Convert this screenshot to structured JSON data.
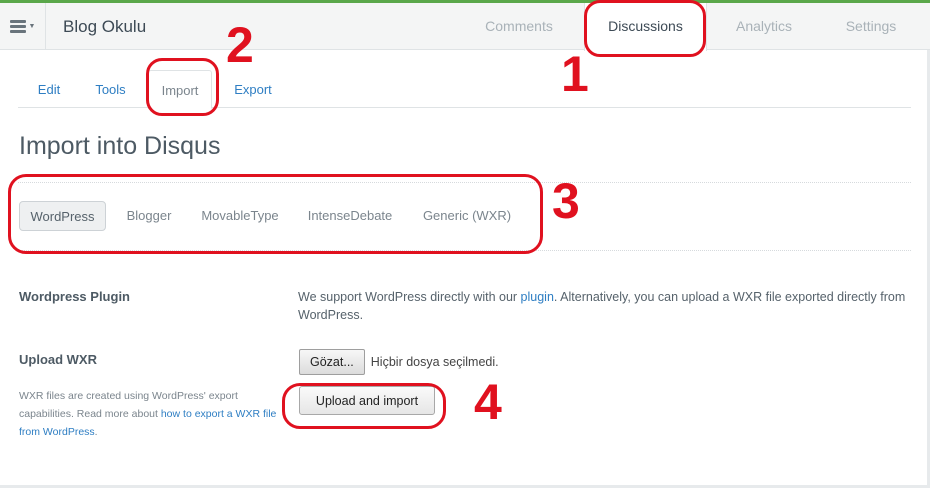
{
  "header": {
    "site_title": "Blog Okulu",
    "menu_icon": "hamburger-menu-icon",
    "tabs": [
      {
        "label": "Comments",
        "active": false
      },
      {
        "label": "Discussions",
        "active": true
      },
      {
        "label": "Analytics",
        "active": false
      },
      {
        "label": "Settings",
        "active": false
      }
    ]
  },
  "subnav": {
    "tabs": [
      {
        "label": "Edit",
        "active": false
      },
      {
        "label": "Tools",
        "active": false
      },
      {
        "label": "Import",
        "active": true
      },
      {
        "label": "Export",
        "active": false
      }
    ]
  },
  "main": {
    "title": "Import into Disqus",
    "platforms": [
      {
        "label": "WordPress",
        "active": true
      },
      {
        "label": "Blogger",
        "active": false
      },
      {
        "label": "MovableType",
        "active": false
      },
      {
        "label": "IntenseDebate",
        "active": false
      },
      {
        "label": "Generic (WXR)",
        "active": false
      }
    ],
    "plugin_section": {
      "label": "Wordpress Plugin",
      "desc_before": "We support WordPress directly with our ",
      "desc_link": "plugin",
      "desc_after": ". Alternatively, you can upload a WXR file exported directly from WordPress."
    },
    "upload_section": {
      "label": "Upload WXR",
      "note_before": "WXR files are created using WordPress' export capabilities. Read more about ",
      "note_link": "how to export a WXR file from WordPress",
      "note_after": ".",
      "browse_label": "Gözat...",
      "file_status": "Hiçbir dosya seçilmedi.",
      "upload_button": "Upload and import"
    }
  },
  "annotations": {
    "color": "#e0111f",
    "numbers": [
      "1",
      "2",
      "3",
      "4"
    ]
  },
  "colors": {
    "accent_green": "#5aa74a",
    "link_blue": "#2e7ec3"
  }
}
